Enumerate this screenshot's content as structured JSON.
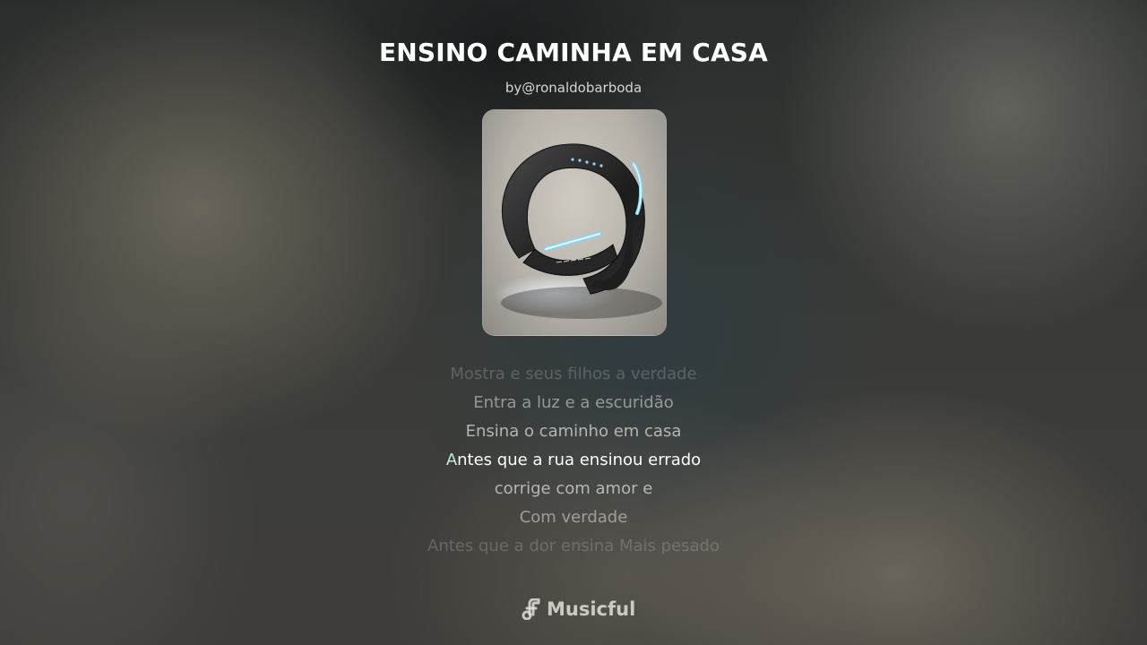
{
  "song": {
    "title": "ENSINO CAMINHA EM CASA",
    "author": "by@ronaldobarboda"
  },
  "cover": {
    "image": "smart-bracelet-artwork"
  },
  "lyrics": {
    "lines": [
      "Mostra e seus filhos a verdade",
      "Entra a luz e a escuridão",
      "Ensina o caminho em casa",
      "Antes que a rua ensinou errado",
      "corrige com amor e",
      "Com verdade",
      "Antes que a dor ensina Mais pesado"
    ],
    "active_index": 3,
    "active_sung_part": "A",
    "active_rest_part": "ntes que a rua ensinou errado"
  },
  "brand": {
    "name": "Musicful",
    "icon": "music-note-icon"
  },
  "colors": {
    "title": "#ffffff",
    "highlight": "#b8f0d8"
  }
}
